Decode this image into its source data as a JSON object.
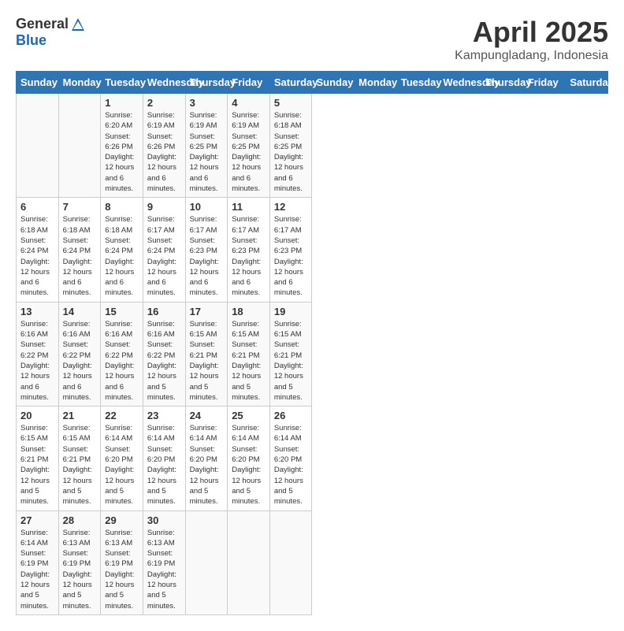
{
  "header": {
    "logo_general": "General",
    "logo_blue": "Blue",
    "month": "April 2025",
    "location": "Kampungladang, Indonesia"
  },
  "days_of_week": [
    "Sunday",
    "Monday",
    "Tuesday",
    "Wednesday",
    "Thursday",
    "Friday",
    "Saturday"
  ],
  "weeks": [
    [
      {
        "day": "",
        "info": ""
      },
      {
        "day": "",
        "info": ""
      },
      {
        "day": "1",
        "info": "Sunrise: 6:20 AM\nSunset: 6:26 PM\nDaylight: 12 hours and 6 minutes."
      },
      {
        "day": "2",
        "info": "Sunrise: 6:19 AM\nSunset: 6:26 PM\nDaylight: 12 hours and 6 minutes."
      },
      {
        "day": "3",
        "info": "Sunrise: 6:19 AM\nSunset: 6:25 PM\nDaylight: 12 hours and 6 minutes."
      },
      {
        "day": "4",
        "info": "Sunrise: 6:19 AM\nSunset: 6:25 PM\nDaylight: 12 hours and 6 minutes."
      },
      {
        "day": "5",
        "info": "Sunrise: 6:18 AM\nSunset: 6:25 PM\nDaylight: 12 hours and 6 minutes."
      }
    ],
    [
      {
        "day": "6",
        "info": "Sunrise: 6:18 AM\nSunset: 6:24 PM\nDaylight: 12 hours and 6 minutes."
      },
      {
        "day": "7",
        "info": "Sunrise: 6:18 AM\nSunset: 6:24 PM\nDaylight: 12 hours and 6 minutes."
      },
      {
        "day": "8",
        "info": "Sunrise: 6:18 AM\nSunset: 6:24 PM\nDaylight: 12 hours and 6 minutes."
      },
      {
        "day": "9",
        "info": "Sunrise: 6:17 AM\nSunset: 6:24 PM\nDaylight: 12 hours and 6 minutes."
      },
      {
        "day": "10",
        "info": "Sunrise: 6:17 AM\nSunset: 6:23 PM\nDaylight: 12 hours and 6 minutes."
      },
      {
        "day": "11",
        "info": "Sunrise: 6:17 AM\nSunset: 6:23 PM\nDaylight: 12 hours and 6 minutes."
      },
      {
        "day": "12",
        "info": "Sunrise: 6:17 AM\nSunset: 6:23 PM\nDaylight: 12 hours and 6 minutes."
      }
    ],
    [
      {
        "day": "13",
        "info": "Sunrise: 6:16 AM\nSunset: 6:22 PM\nDaylight: 12 hours and 6 minutes."
      },
      {
        "day": "14",
        "info": "Sunrise: 6:16 AM\nSunset: 6:22 PM\nDaylight: 12 hours and 6 minutes."
      },
      {
        "day": "15",
        "info": "Sunrise: 6:16 AM\nSunset: 6:22 PM\nDaylight: 12 hours and 6 minutes."
      },
      {
        "day": "16",
        "info": "Sunrise: 6:16 AM\nSunset: 6:22 PM\nDaylight: 12 hours and 5 minutes."
      },
      {
        "day": "17",
        "info": "Sunrise: 6:15 AM\nSunset: 6:21 PM\nDaylight: 12 hours and 5 minutes."
      },
      {
        "day": "18",
        "info": "Sunrise: 6:15 AM\nSunset: 6:21 PM\nDaylight: 12 hours and 5 minutes."
      },
      {
        "day": "19",
        "info": "Sunrise: 6:15 AM\nSunset: 6:21 PM\nDaylight: 12 hours and 5 minutes."
      }
    ],
    [
      {
        "day": "20",
        "info": "Sunrise: 6:15 AM\nSunset: 6:21 PM\nDaylight: 12 hours and 5 minutes."
      },
      {
        "day": "21",
        "info": "Sunrise: 6:15 AM\nSunset: 6:21 PM\nDaylight: 12 hours and 5 minutes."
      },
      {
        "day": "22",
        "info": "Sunrise: 6:14 AM\nSunset: 6:20 PM\nDaylight: 12 hours and 5 minutes."
      },
      {
        "day": "23",
        "info": "Sunrise: 6:14 AM\nSunset: 6:20 PM\nDaylight: 12 hours and 5 minutes."
      },
      {
        "day": "24",
        "info": "Sunrise: 6:14 AM\nSunset: 6:20 PM\nDaylight: 12 hours and 5 minutes."
      },
      {
        "day": "25",
        "info": "Sunrise: 6:14 AM\nSunset: 6:20 PM\nDaylight: 12 hours and 5 minutes."
      },
      {
        "day": "26",
        "info": "Sunrise: 6:14 AM\nSunset: 6:20 PM\nDaylight: 12 hours and 5 minutes."
      }
    ],
    [
      {
        "day": "27",
        "info": "Sunrise: 6:14 AM\nSunset: 6:19 PM\nDaylight: 12 hours and 5 minutes."
      },
      {
        "day": "28",
        "info": "Sunrise: 6:13 AM\nSunset: 6:19 PM\nDaylight: 12 hours and 5 minutes."
      },
      {
        "day": "29",
        "info": "Sunrise: 6:13 AM\nSunset: 6:19 PM\nDaylight: 12 hours and 5 minutes."
      },
      {
        "day": "30",
        "info": "Sunrise: 6:13 AM\nSunset: 6:19 PM\nDaylight: 12 hours and 5 minutes."
      },
      {
        "day": "",
        "info": ""
      },
      {
        "day": "",
        "info": ""
      },
      {
        "day": "",
        "info": ""
      }
    ]
  ]
}
